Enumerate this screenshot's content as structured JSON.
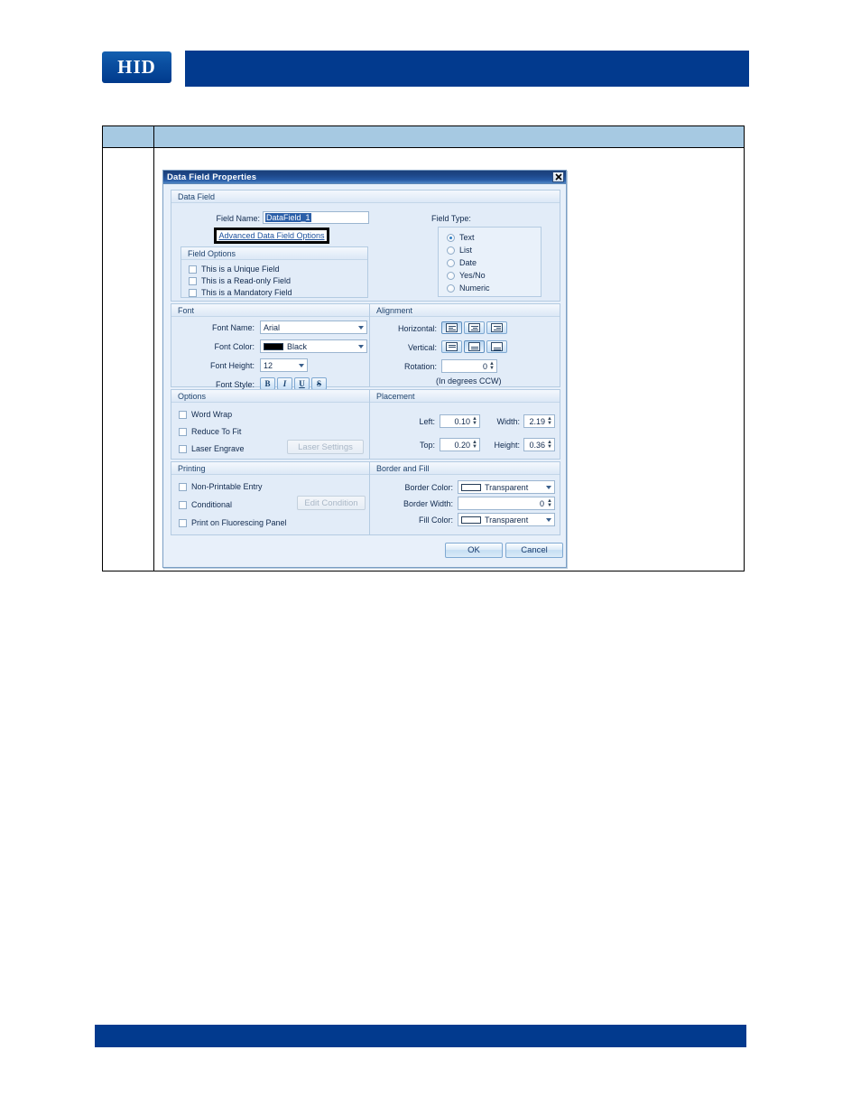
{
  "header": {
    "logo_text": "HID",
    "logo_name": "hid-logo",
    "bar_color": "#023a8e"
  },
  "table": {
    "col1_header": "",
    "col2_header": "",
    "header_bg": "#a6c9e2"
  },
  "footer": {
    "bar_color": "#023a8e"
  },
  "dialog": {
    "title": "Data Field Properties",
    "close_glyph": "✕",
    "data_field": {
      "group_title": "Data Field",
      "field_name_label": "Field Name:",
      "field_name_value": "DataField_1",
      "advanced_link": "Advanced Data Field Options",
      "field_options_title": "Field Options",
      "checkboxes": [
        {
          "label": "This is a Unique Field",
          "checked": false
        },
        {
          "label": "This is a Read-only Field",
          "checked": false
        },
        {
          "label": "This is a Mandatory Field",
          "checked": false
        }
      ],
      "field_type_label": "Field Type:",
      "field_types": [
        {
          "label": "Text",
          "selected": true
        },
        {
          "label": "List",
          "selected": false
        },
        {
          "label": "Date",
          "selected": false
        },
        {
          "label": "Yes/No",
          "selected": false
        },
        {
          "label": "Numeric",
          "selected": false
        }
      ]
    },
    "font": {
      "group_title": "Font",
      "font_name_label": "Font Name:",
      "font_name_value": "Arial",
      "font_color_label": "Font Color:",
      "font_color_value": "Black",
      "font_color_hex": "#000000",
      "font_height_label": "Font Height:",
      "font_height_value": "12",
      "font_style_label": "Font Style:",
      "style_buttons": [
        {
          "label": "B",
          "name": "bold-button",
          "pressed": false
        },
        {
          "label": "I",
          "name": "italic-button",
          "pressed": false
        },
        {
          "label": "U",
          "name": "underline-button",
          "pressed": false
        },
        {
          "label": "S",
          "name": "strikethrough-button",
          "pressed": false
        }
      ]
    },
    "alignment": {
      "group_title": "Alignment",
      "horizontal_label": "Horizontal:",
      "horizontal_options": [
        "align-left",
        "align-center",
        "align-right"
      ],
      "horizontal_selected": 0,
      "vertical_label": "Vertical:",
      "vertical_options": [
        "align-top",
        "align-middle",
        "align-bottom"
      ],
      "vertical_selected": 1,
      "rotation_label": "Rotation:",
      "rotation_value": "0",
      "rotation_hint": "(In degrees CCW)"
    },
    "options": {
      "group_title": "Options",
      "checkboxes": [
        {
          "label": "Word Wrap",
          "checked": false
        },
        {
          "label": "Reduce To Fit",
          "checked": false
        },
        {
          "label": "Laser Engrave",
          "checked": false
        }
      ],
      "laser_settings_button": "Laser Settings",
      "laser_settings_disabled": true
    },
    "placement": {
      "group_title": "Placement",
      "left_label": "Left:",
      "left_value": "0.10",
      "width_label": "Width:",
      "width_value": "2.19",
      "top_label": "Top:",
      "top_value": "0.20",
      "height_label": "Height:",
      "height_value": "0.36"
    },
    "printing": {
      "group_title": "Printing",
      "checkboxes": [
        {
          "label": "Non-Printable Entry",
          "checked": false
        },
        {
          "label": "Conditional",
          "checked": false
        },
        {
          "label": "Print on Fluorescing Panel",
          "checked": false
        }
      ],
      "edit_condition_button": "Edit Condition",
      "edit_condition_disabled": true
    },
    "border_fill": {
      "group_title": "Border and Fill",
      "border_color_label": "Border Color:",
      "border_color_value": "Transparent",
      "border_width_label": "Border Width:",
      "border_width_value": "0",
      "fill_color_label": "Fill Color:",
      "fill_color_value": "Transparent"
    },
    "buttons": {
      "ok": "OK",
      "cancel": "Cancel"
    }
  }
}
